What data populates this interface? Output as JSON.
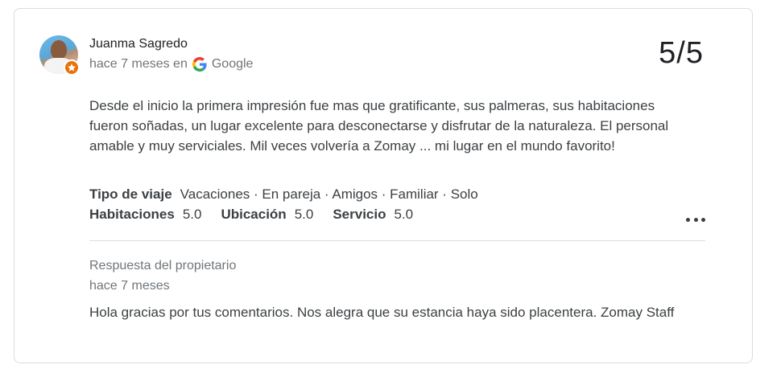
{
  "review": {
    "author": "Juanma Sagredo",
    "time": "hace 7 meses en",
    "source": "Google",
    "rating": "5/5",
    "text": "Desde el inicio la primera impresión fue mas que gratificante, sus palmeras, sus habitaciones fueron soñadas, un lugar excelente para desconectarse y disfrutar de la naturaleza. El personal amable y muy serviciales. Mil veces volvería a Zomay ... mi lugar en el mundo favorito!",
    "trip_label": "Tipo de viaje",
    "trip_value": "Vacaciones · En pareja · Amigos · Familiar · Solo",
    "scores": [
      {
        "label": "Habitaciones",
        "value": "5.0"
      },
      {
        "label": "Ubicación",
        "value": "5.0"
      },
      {
        "label": "Servicio",
        "value": "5.0"
      }
    ]
  },
  "owner_response": {
    "title": "Respuesta del propietario",
    "time": "hace 7 meses",
    "text": "Hola gracias por tus comentarios. Nos alegra que su estancia haya sido placentera. Zomay Staff"
  },
  "colors": {
    "badge": "#e8710a",
    "google_blue": "#4285F4",
    "google_red": "#EA4335",
    "google_yellow": "#FBBC05",
    "google_green": "#34A853"
  },
  "icons": {
    "avatar": "user-avatar",
    "badge": "local-guide-star-icon",
    "source": "google-g-icon",
    "more": "more-horiz-icon"
  }
}
